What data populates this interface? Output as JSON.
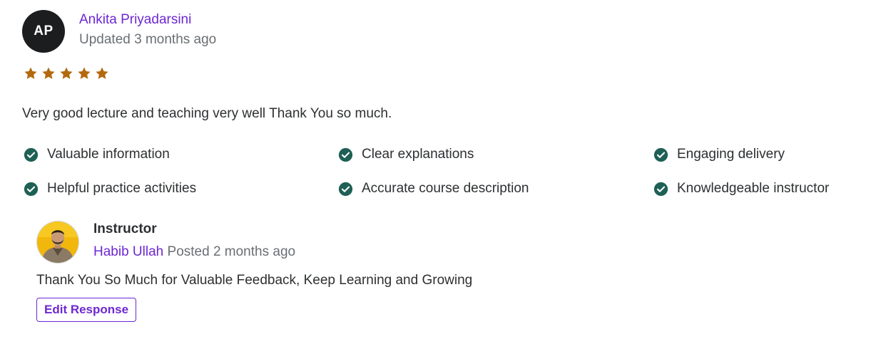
{
  "review": {
    "avatar_initials": "AP",
    "reviewer_name": "Ankita Priyadarsini",
    "updated": "Updated 3 months ago",
    "rating": 5,
    "rating_max": 5,
    "star_color": "#b4690e",
    "text": "Very good lecture and teaching very well Thank You so much.",
    "tags": [
      "Valuable information",
      "Clear explanations",
      "Engaging delivery",
      "Helpful practice activities",
      "Accurate course description",
      "Knowledgeable instructor"
    ],
    "tag_icon": "check-circle-icon",
    "tag_icon_color": "#1e6055"
  },
  "response": {
    "heading": "Instructor",
    "instructor_name": "Habib Ullah",
    "posted": "Posted 2 months ago",
    "text": "Thank You So Much for Valuable Feedback, Keep Learning and Growing",
    "edit_label": "Edit Response"
  },
  "colors": {
    "accent": "#6d28d2",
    "text": "#2d2f31",
    "muted": "#6a6f73",
    "avatar_bg": "#1c1d1f"
  }
}
